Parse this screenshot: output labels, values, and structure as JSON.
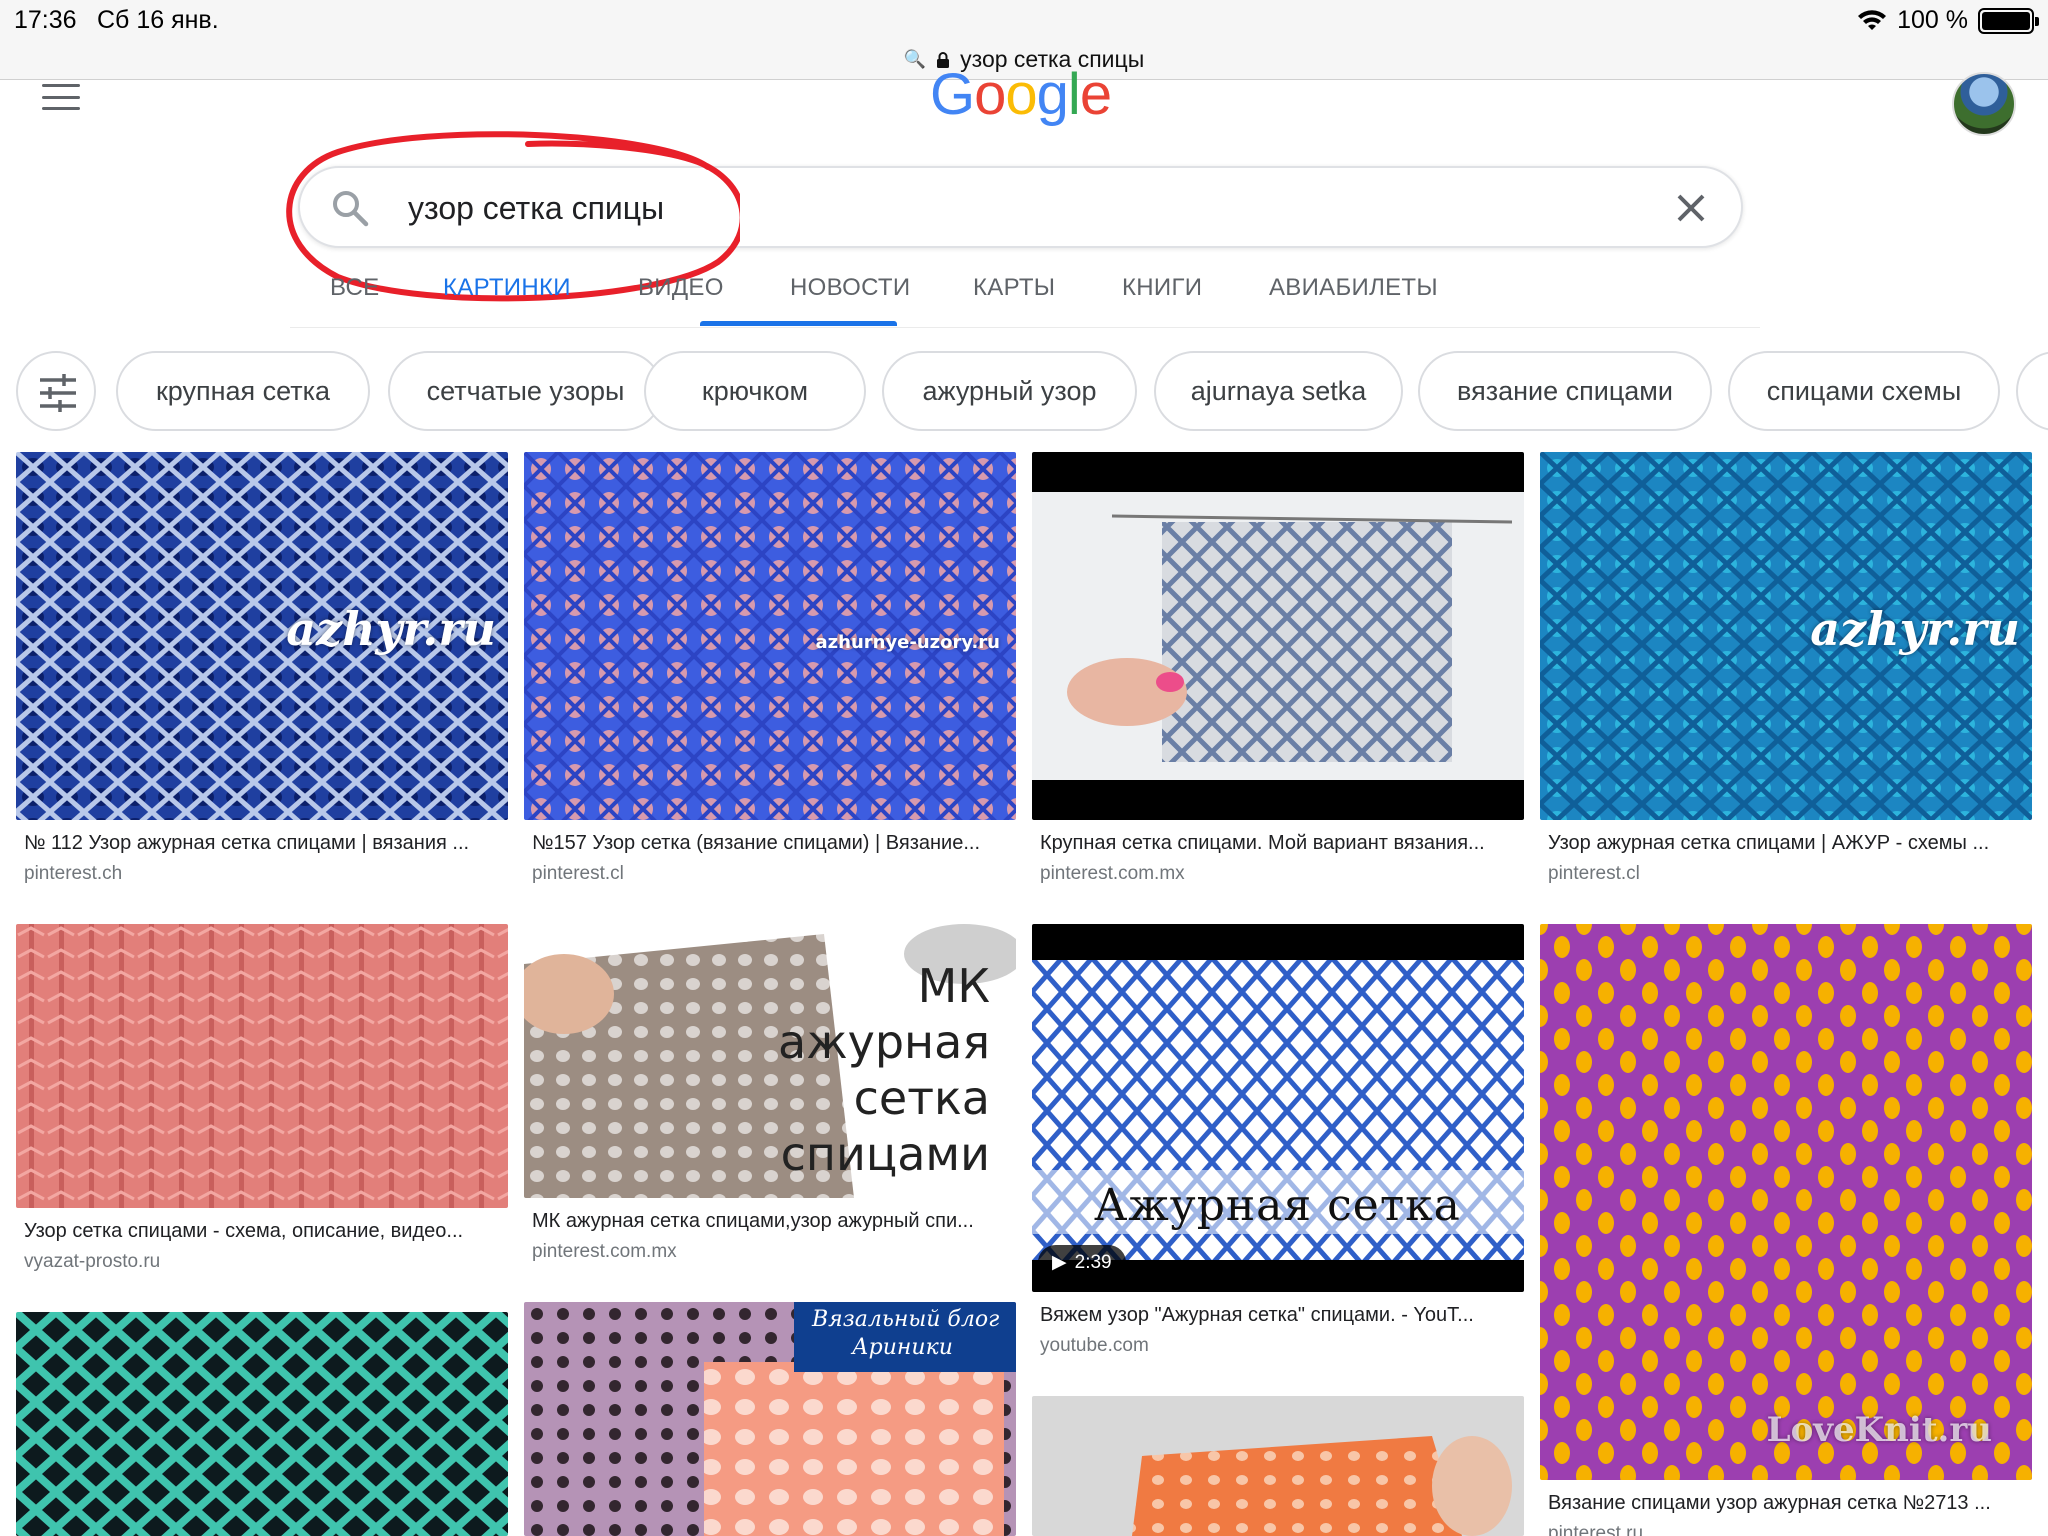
{
  "status_bar": {
    "time": "17:36",
    "date": "Сб 16 янв.",
    "battery": "100 %"
  },
  "url_bar": {
    "text": "узор сетка спицы"
  },
  "header": {
    "logo": [
      "G",
      "o",
      "o",
      "g",
      "l",
      "e"
    ],
    "logo_colors": [
      "#4285F4",
      "#EA4335",
      "#FBBC05",
      "#4285F4",
      "#34A853",
      "#EA4335"
    ]
  },
  "search": {
    "query": "узор сетка спицы"
  },
  "tabs": [
    {
      "label": "ВСЕ",
      "active": false
    },
    {
      "label": "КАРТИНКИ",
      "active": true
    },
    {
      "label": "ВИДЕО",
      "active": false
    },
    {
      "label": "НОВОСТИ",
      "active": false
    },
    {
      "label": "КАРТЫ",
      "active": false
    },
    {
      "label": "КНИГИ",
      "active": false
    },
    {
      "label": "АВИАБИЛЕТЫ",
      "active": false
    }
  ],
  "chips": [
    "крупная сетка",
    "сетчатые узоры",
    "крючком",
    "ажурный узор",
    "ajurnaya setka",
    "вязание спицами",
    "спицами схемы"
  ],
  "accent": "#1a73e8",
  "annotation_color": "#e8202a",
  "results": [
    {
      "caption": "№ 112 Узор ажурная сетка спицами | вязания ...",
      "source": "pinterest.ch",
      "watermark": "azhyr.ru"
    },
    {
      "caption": "№157 Узор сетка (вязание спицами) | Вязание...",
      "source": "pinterest.cl",
      "watermark": "azhurnye-uzory.ru"
    },
    {
      "caption": "Крупная сетка спицами. Мой вариант вязания...",
      "source": "pinterest.com.mx"
    },
    {
      "caption": "Узор ажурная сетка спицами | АЖУР - схемы ...",
      "source": "pinterest.cl",
      "watermark": "azhyr.ru"
    },
    {
      "caption": "Узор сетка спицами - схема, описание, видео...",
      "source": "vyazat-prosto.ru"
    },
    {
      "caption": "МК ажурная сетка спицами,узор ажурный спи...",
      "source": "pinterest.com.mx",
      "overlay_lines": [
        "МК",
        "ажурная",
        "сетка",
        "спицами"
      ]
    },
    {
      "caption": "Вяжем узор \"Ажурная сетка\" спицами. - YouT...",
      "source": "youtube.com",
      "overlay": "Ажурная сетка",
      "duration": "2:39"
    },
    {
      "caption": "Вязание спицами узор ажурная сетка №2713 ...",
      "source": "pinterest.ru",
      "watermark": "LoveKnit.ru"
    },
    {
      "overlay_lines": [
        "Вязальный блог",
        "Ариники"
      ]
    }
  ]
}
